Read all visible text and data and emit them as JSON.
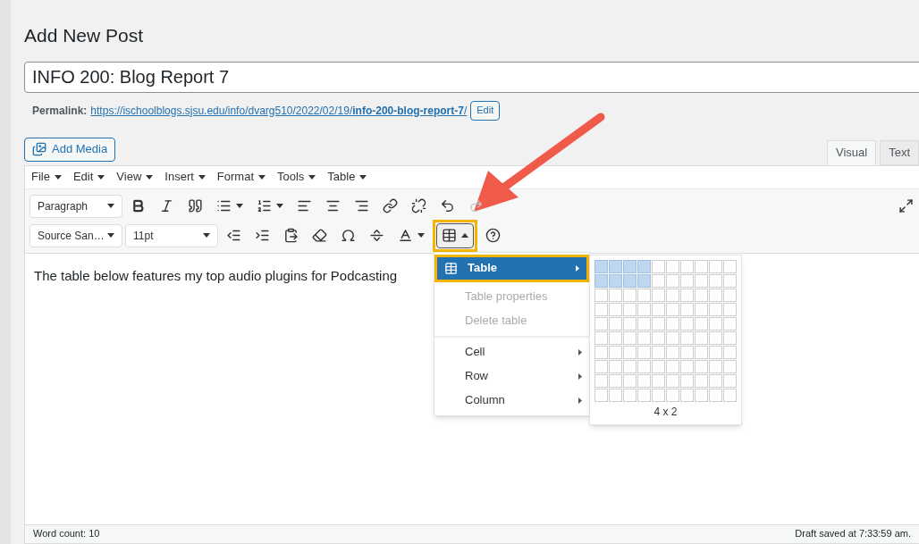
{
  "page_title": "Add New Post",
  "post_title": {
    "value": "INFO 200: Blog Report 7"
  },
  "permalink": {
    "label": "Permalink:",
    "url_start": "https://ischoolblogs.sjsu.edu/info/dvarg510/2022/02/19/",
    "url_slug": "info-200-blog-report-7",
    "url_end": "/",
    "edit_button": "Edit"
  },
  "add_media": "Add Media",
  "editor_tabs": [
    {
      "label": "Visual",
      "selected": true
    },
    {
      "label": "Text",
      "selected": false
    }
  ],
  "menubar": [
    "File",
    "Edit",
    "View",
    "Insert",
    "Format",
    "Tools",
    "Table"
  ],
  "toolbar_rows": [
    [
      {
        "kind": "select",
        "value": "Paragraph"
      },
      {
        "kind": "bold",
        "disabled": false
      },
      {
        "kind": "italic",
        "disabled": false
      },
      {
        "kind": "quote",
        "disabled": false
      },
      {
        "kind": "bullets",
        "disabled": false,
        "dropdown": true
      },
      {
        "kind": "numbers",
        "disabled": false,
        "dropdown": true
      },
      {
        "kind": "align-left",
        "disabled": false
      },
      {
        "kind": "align-center",
        "disabled": false
      },
      {
        "kind": "align-right",
        "disabled": false
      },
      {
        "kind": "link",
        "disabled": false
      },
      {
        "kind": "unlink",
        "disabled": false
      },
      {
        "kind": "undo",
        "disabled": false
      },
      {
        "kind": "redo",
        "disabled": true
      }
    ],
    [
      {
        "kind": "select",
        "value": "Source San…"
      },
      {
        "kind": "select",
        "value": "11pt"
      },
      {
        "kind": "outdent",
        "disabled": false
      },
      {
        "kind": "indent",
        "disabled": false
      },
      {
        "kind": "paste",
        "disabled": false
      },
      {
        "kind": "eraser",
        "disabled": false
      },
      {
        "kind": "omega",
        "disabled": false
      },
      {
        "kind": "more",
        "disabled": false
      },
      {
        "kind": "text-color",
        "disabled": false,
        "dropdown": true
      },
      {
        "kind": "table",
        "disabled": false,
        "active": true,
        "highlighted": true
      },
      {
        "kind": "help",
        "disabled": false
      }
    ]
  ],
  "content": "The table below features my top audio plugins for Podcasting",
  "table_menu": {
    "items": [
      {
        "kind": "item",
        "label": "Table",
        "icon": true,
        "submenu": true,
        "selected": true,
        "disabled": false,
        "highlighted": true
      },
      {
        "kind": "item",
        "label": "Table properties",
        "submenu": false,
        "selected": false,
        "disabled": true
      },
      {
        "kind": "item",
        "label": "Delete table",
        "submenu": false,
        "selected": false,
        "disabled": true
      },
      {
        "kind": "separator"
      },
      {
        "kind": "item",
        "label": "Cell",
        "submenu": true,
        "selected": false,
        "disabled": false
      },
      {
        "kind": "item",
        "label": "Row",
        "submenu": true,
        "selected": false,
        "disabled": false
      },
      {
        "kind": "item",
        "label": "Column",
        "submenu": true,
        "selected": false,
        "disabled": false
      }
    ]
  },
  "table_grid": {
    "size_label": "4 x 2",
    "rows": [
      [
        true,
        true,
        true,
        true,
        false,
        false,
        false,
        false,
        false,
        false
      ],
      [
        true,
        true,
        true,
        true,
        false,
        false,
        false,
        false,
        false,
        false
      ],
      [
        false,
        false,
        false,
        false,
        false,
        false,
        false,
        false,
        false,
        false
      ],
      [
        false,
        false,
        false,
        false,
        false,
        false,
        false,
        false,
        false,
        false
      ],
      [
        false,
        false,
        false,
        false,
        false,
        false,
        false,
        false,
        false,
        false
      ],
      [
        false,
        false,
        false,
        false,
        false,
        false,
        false,
        false,
        false,
        false
      ],
      [
        false,
        false,
        false,
        false,
        false,
        false,
        false,
        false,
        false,
        false
      ],
      [
        false,
        false,
        false,
        false,
        false,
        false,
        false,
        false,
        false,
        false
      ],
      [
        false,
        false,
        false,
        false,
        false,
        false,
        false,
        false,
        false,
        false
      ],
      [
        false,
        false,
        false,
        false,
        false,
        false,
        false,
        false,
        false,
        false
      ]
    ]
  },
  "status_bar": {
    "word_count": "Word count: 10",
    "draft_saved": "Draft saved at 7:33:59 am."
  }
}
